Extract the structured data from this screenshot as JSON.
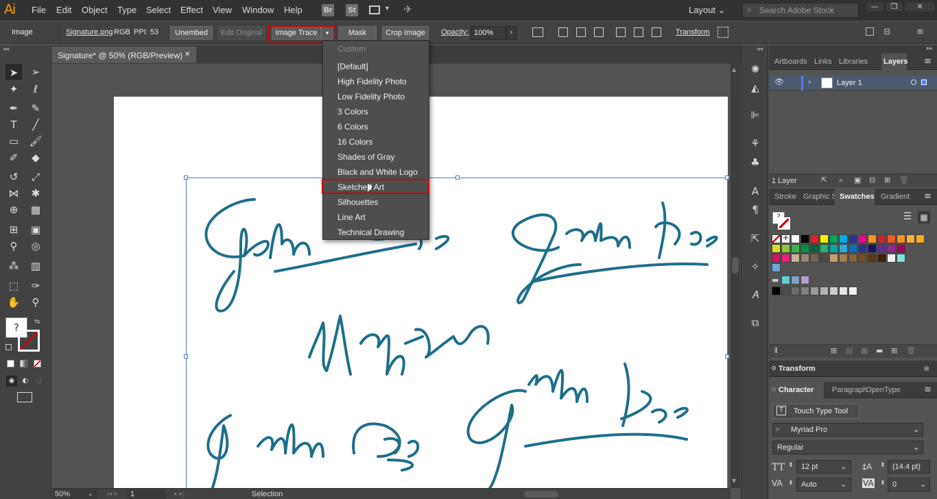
{
  "menubar": {
    "logo": "Ai",
    "items": [
      "File",
      "Edit",
      "Object",
      "Type",
      "Select",
      "Effect",
      "View",
      "Window",
      "Help"
    ],
    "app_icons": [
      "Br",
      "St"
    ],
    "workspace": "Layout",
    "search_placeholder": "Search Adobe Stock",
    "window_controls": [
      "—",
      "❐",
      "✕"
    ]
  },
  "control": {
    "object_type": "Image",
    "filename": "Signature.png",
    "color_mode": "RGB",
    "ppi": "PPI: 53",
    "unembed": "Unembed",
    "edit_original": "Edit Original",
    "image_trace": "Image Trace",
    "mask": "Mask",
    "crop_image": "Crop Image",
    "opacity_label": "Opacity:",
    "opacity_value": "100%",
    "transform": "Transform"
  },
  "document": {
    "tab_title": "Signature* @ 50% (RGB/Preview)",
    "close": "✕"
  },
  "trace_presets": {
    "items": [
      "Custom",
      "[Default]",
      "High Fidelity Photo",
      "Low Fidelity Photo",
      "3 Colors",
      "6 Colors",
      "16 Colors",
      "Shades of Gray",
      "Black and White Logo",
      "Sketched Art",
      "Silhouettes",
      "Line Art",
      "Technical Drawing"
    ],
    "disabled": [
      "Custom"
    ],
    "highlighted": "Sketched Art"
  },
  "artwork": {
    "signatures": [
      "John Doe",
      "John Doe",
      "Mattew",
      "John Doe",
      "John Doe"
    ],
    "ink_color": "#1d6f8c"
  },
  "status": {
    "zoom": "50%",
    "artboard_number": "1",
    "tool": "Selection"
  },
  "layers_panel": {
    "tabs": [
      "Artboards",
      "Links",
      "Libraries",
      "Layers"
    ],
    "active_tab": "Layers",
    "layer_name": "Layer 1",
    "layer_count": "1 Layer"
  },
  "swatches_panel": {
    "tabs": [
      "Stroke",
      "Graphic S",
      "Swatches",
      "Gradient"
    ],
    "active_tab": "Swatches",
    "row1": [
      "#ffffff",
      "#000000",
      "#ed1c24",
      "#fff200",
      "#00a651",
      "#00aeef",
      "#2e3192",
      "#ec008c",
      "#f7941d",
      "#c1272d",
      "#f15a24",
      "#f7931e",
      "#fbb03b",
      "#f7ae1e"
    ],
    "row2": [
      "#d9e021",
      "#8cc63f",
      "#39b54a",
      "#009245",
      "#006837",
      "#22b573",
      "#00a99d",
      "#29abe2",
      "#0071bc",
      "#2e3192",
      "#1b1464",
      "#662d91",
      "#93278f",
      "#9e005d"
    ],
    "row3": [
      "#d4145a",
      "#ed1e79",
      "#c7b299",
      "#998675",
      "#736357",
      "#534741",
      "#c69c6d",
      "#a67c52",
      "#8c6239",
      "#754c24",
      "#603813",
      "#42210b",
      "#f2f2f2",
      "#7fe3e0"
    ],
    "row4": [
      "#4d4d4d",
      "#6a6a6a",
      "#808080",
      "#999999",
      "#b3b3b3",
      "#cccccc",
      "#e6e6e6",
      "#f2f2f2"
    ],
    "folder_colors": [
      "#5fd2d4",
      "#7f9fc4",
      "#b79bd3"
    ]
  },
  "transform_panel": {
    "title": "Transform"
  },
  "character_panel": {
    "tabs": [
      "Character",
      "Paragraph",
      "OpenType"
    ],
    "active_tab": "Character",
    "touch_type": "Touch Type Tool",
    "font_family": "Myriad Pro",
    "font_style": "Regular",
    "font_size": "12 pt",
    "leading": "(14.4 pt)",
    "kerning": "Auto",
    "tracking": "0"
  }
}
